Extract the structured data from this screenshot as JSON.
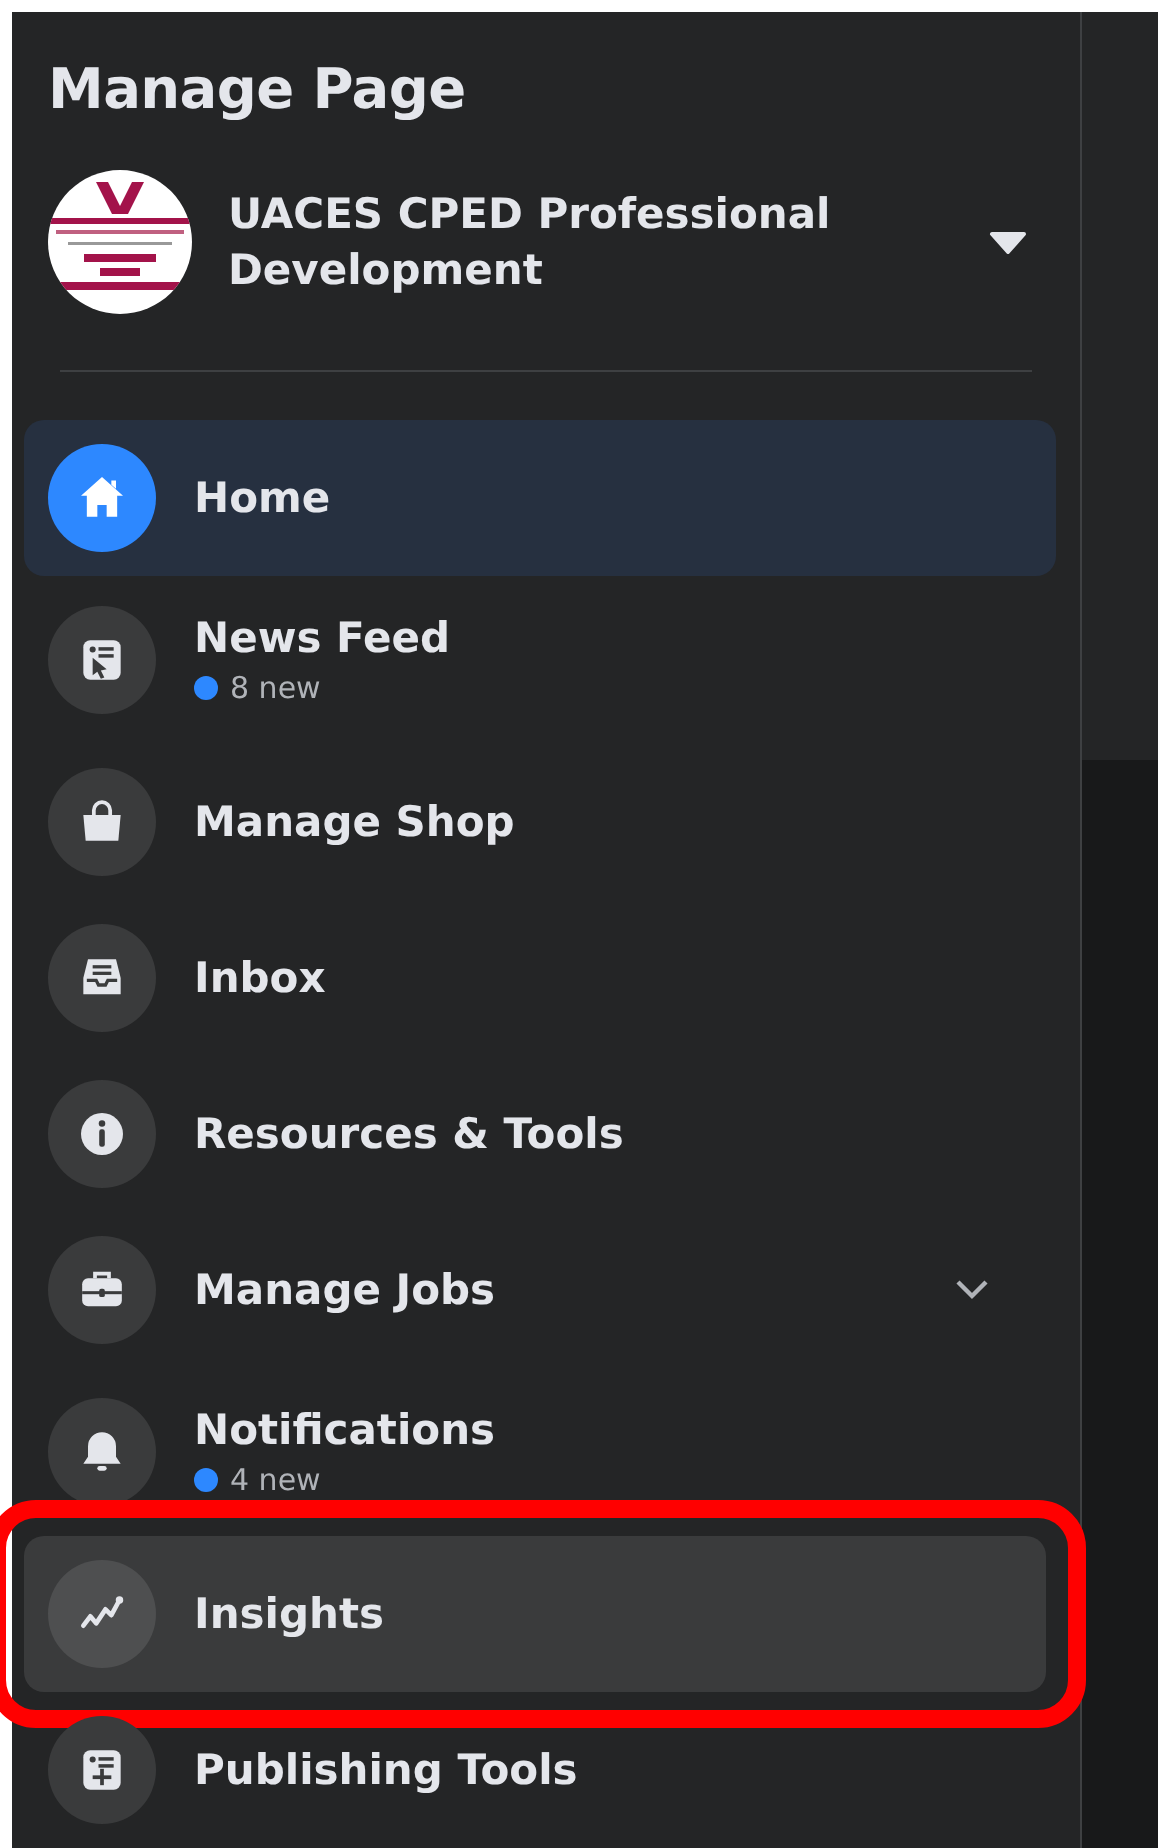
{
  "sidebar": {
    "title": "Manage Page",
    "page": {
      "name": "UACES CPED Professional Development"
    },
    "items": [
      {
        "label": "Home",
        "kind": "link",
        "selected": true,
        "hovered": false,
        "highlighted": false
      },
      {
        "label": "News Feed",
        "kind": "link",
        "badge": "8 new",
        "color": "#2d88ff",
        "selected": false,
        "hovered": false,
        "highlighted": false
      },
      {
        "label": "Manage Shop",
        "kind": "link",
        "selected": false,
        "hovered": false,
        "highlighted": false
      },
      {
        "label": "Inbox",
        "kind": "link",
        "selected": false,
        "hovered": false,
        "highlighted": false
      },
      {
        "label": "Resources & Tools",
        "kind": "link",
        "selected": false,
        "hovered": false,
        "highlighted": false
      },
      {
        "label": "Manage Jobs",
        "kind": "expandable",
        "expanded": false,
        "selected": false,
        "hovered": false,
        "highlighted": false
      },
      {
        "label": "Notifications",
        "kind": "link",
        "badge": "4 new",
        "color": "#2d88ff",
        "selected": false,
        "hovered": false,
        "highlighted": false
      },
      {
        "label": "Insights",
        "kind": "link",
        "selected": false,
        "hovered": true,
        "highlighted": true
      },
      {
        "label": "Publishing Tools",
        "kind": "link",
        "selected": false,
        "hovered": false,
        "highlighted": false
      }
    ]
  }
}
